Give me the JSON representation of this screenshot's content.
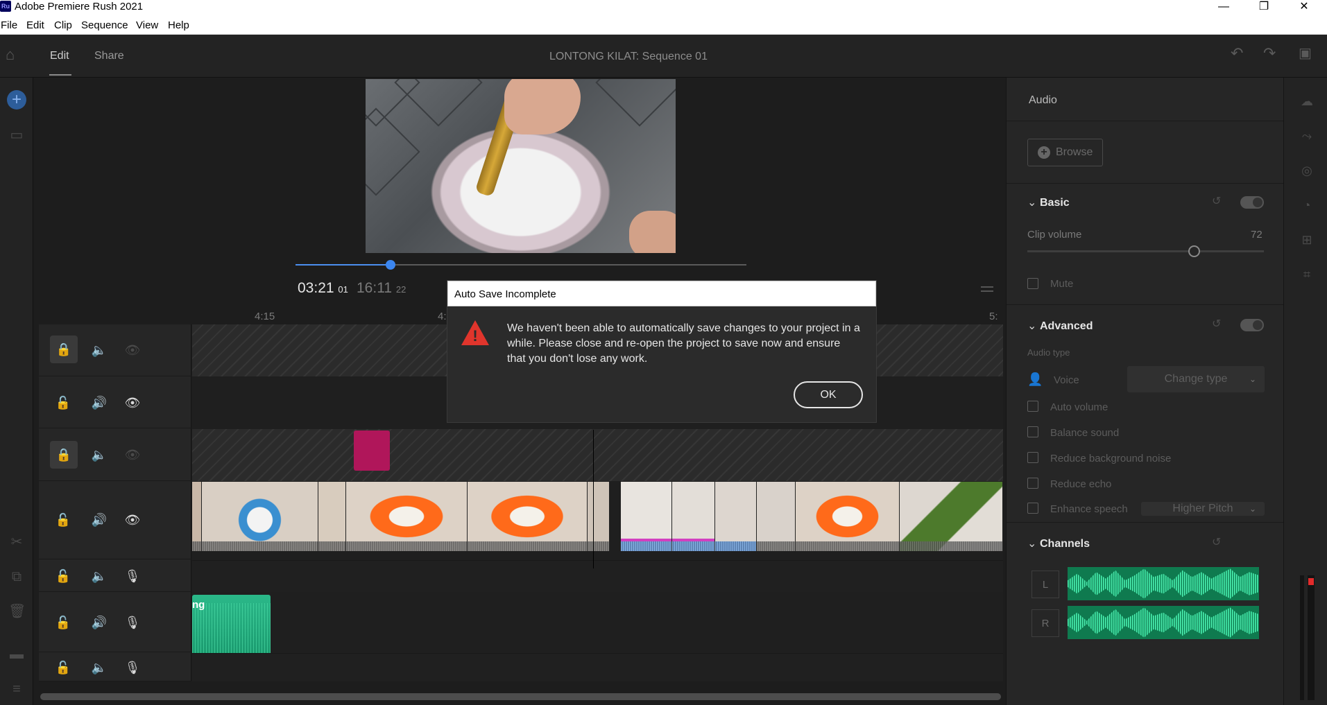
{
  "window": {
    "app_badge": "Ru",
    "title": "Adobe Premiere Rush 2021",
    "minimize": "—",
    "maximize": "❐",
    "close": "✕"
  },
  "menu": [
    "File",
    "Edit",
    "Clip",
    "Sequence",
    "View",
    "Help"
  ],
  "header": {
    "tabs": [
      {
        "label": "Edit",
        "active": true
      },
      {
        "label": "Share",
        "active": false
      }
    ],
    "sequence_title": "LONTONG KILAT: Sequence 01"
  },
  "preview": {
    "current_time": "03:21",
    "current_frames": "01",
    "total_time": "16:11",
    "total_frames": "22",
    "progress": 0.21
  },
  "ruler_labels": [
    "4:15",
    "4:",
    "5:"
  ],
  "music_clip_label": "ng",
  "right_panel": {
    "title": "Audio",
    "browse_label": "Browse",
    "basic": {
      "heading": "Basic",
      "clip_volume_label": "Clip volume",
      "clip_volume_value": "72",
      "mute_label": "Mute"
    },
    "advanced": {
      "heading": "Advanced",
      "audio_type_label": "Audio type",
      "voice_label": "Voice",
      "change_type_label": "Change type",
      "options": [
        "Auto volume",
        "Balance sound",
        "Reduce background noise",
        "Reduce echo",
        "Enhance speech"
      ],
      "enhance_speech_value": "Higher Pitch"
    },
    "channels": {
      "heading": "Channels",
      "left": "L",
      "right": "R"
    }
  },
  "dialog": {
    "title": "Auto Save Incomplete",
    "message": "We haven't been able to automatically save changes to your project in a while. Please close and re-open the project to save now and ensure that you don't lose any work.",
    "ok_label": "OK"
  },
  "colors": {
    "accent_blue": "#3b86f0",
    "warning_red": "#e0352c",
    "audio_green": "#2cc489",
    "graphic_pink": "#b0165a"
  }
}
